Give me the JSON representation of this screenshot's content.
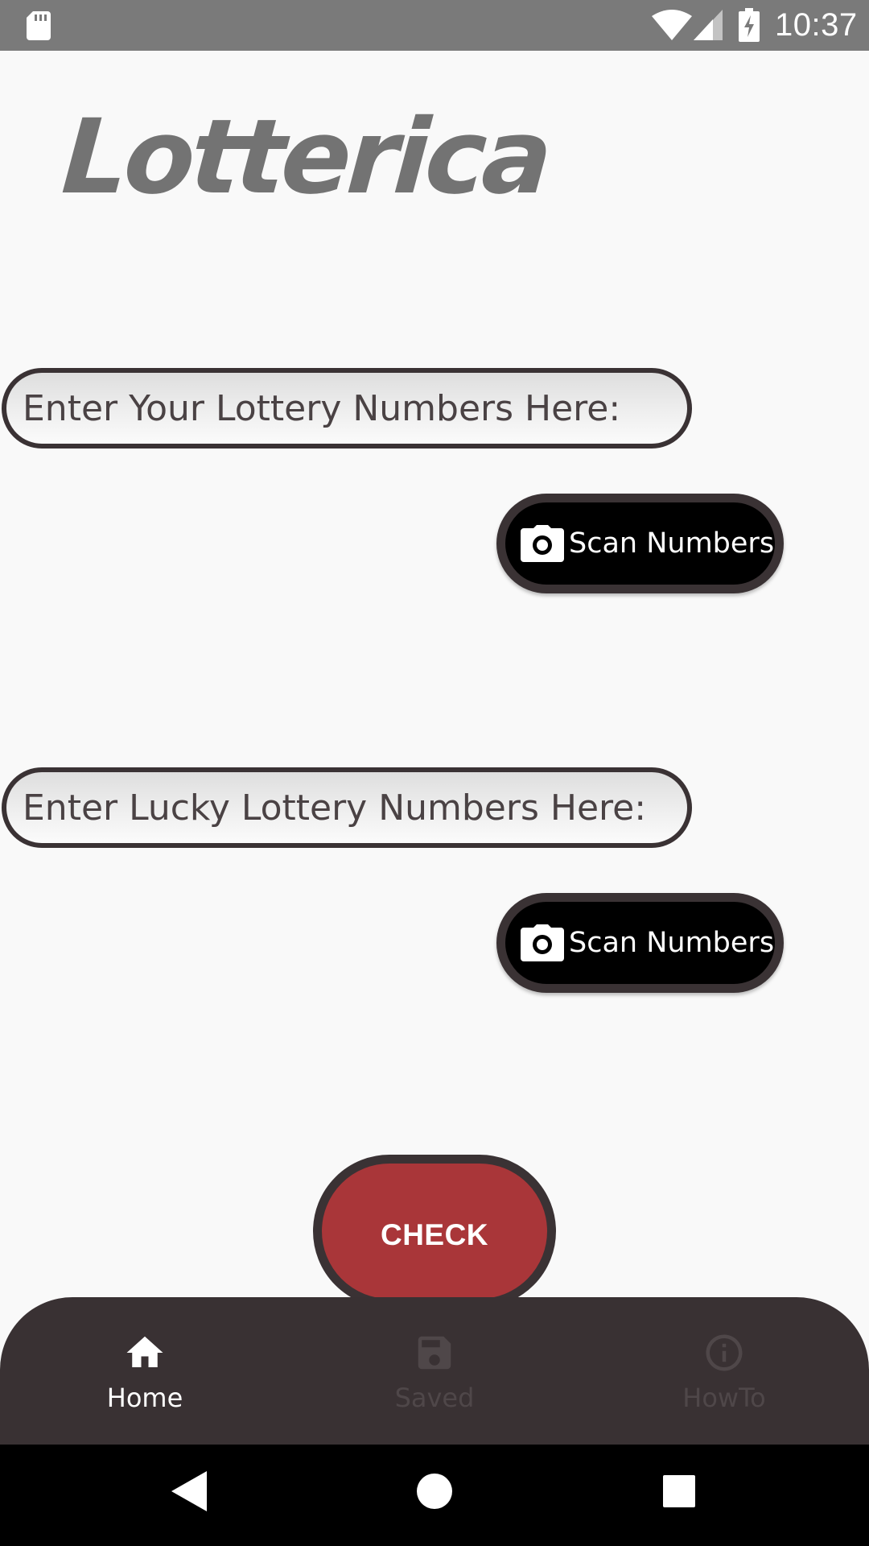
{
  "status_bar": {
    "time": "10:37",
    "icons": [
      "sd-card-icon",
      "wifi-icon",
      "signal-icon",
      "battery-charging-icon"
    ]
  },
  "app": {
    "logo_text": "Lotterica"
  },
  "inputs": {
    "your_numbers": {
      "placeholder": "Enter Your Lottery Numbers Here:",
      "value": ""
    },
    "lucky_numbers": {
      "placeholder": "Enter Lucky Lottery Numbers Here:",
      "value": ""
    }
  },
  "buttons": {
    "scan_label": "Scan Numbers",
    "check_label": "CHECK"
  },
  "bottom_nav": {
    "items": [
      {
        "label": "Home",
        "icon": "home-icon",
        "active": true
      },
      {
        "label": "Saved",
        "icon": "save-icon",
        "active": false
      },
      {
        "label": "HowTo",
        "icon": "info-icon",
        "active": false
      }
    ]
  },
  "system_nav": {
    "icons": [
      "back-icon",
      "home-circle-icon",
      "recents-icon"
    ]
  },
  "colors": {
    "status_bar": "#7a7a7a",
    "background": "#f9f9f9",
    "logo": "#737373",
    "border_dark": "#3a3234",
    "check_button": "#a93639",
    "nav_background": "#393133",
    "nav_active": "#ffffff",
    "nav_inactive": "#4f4749"
  }
}
